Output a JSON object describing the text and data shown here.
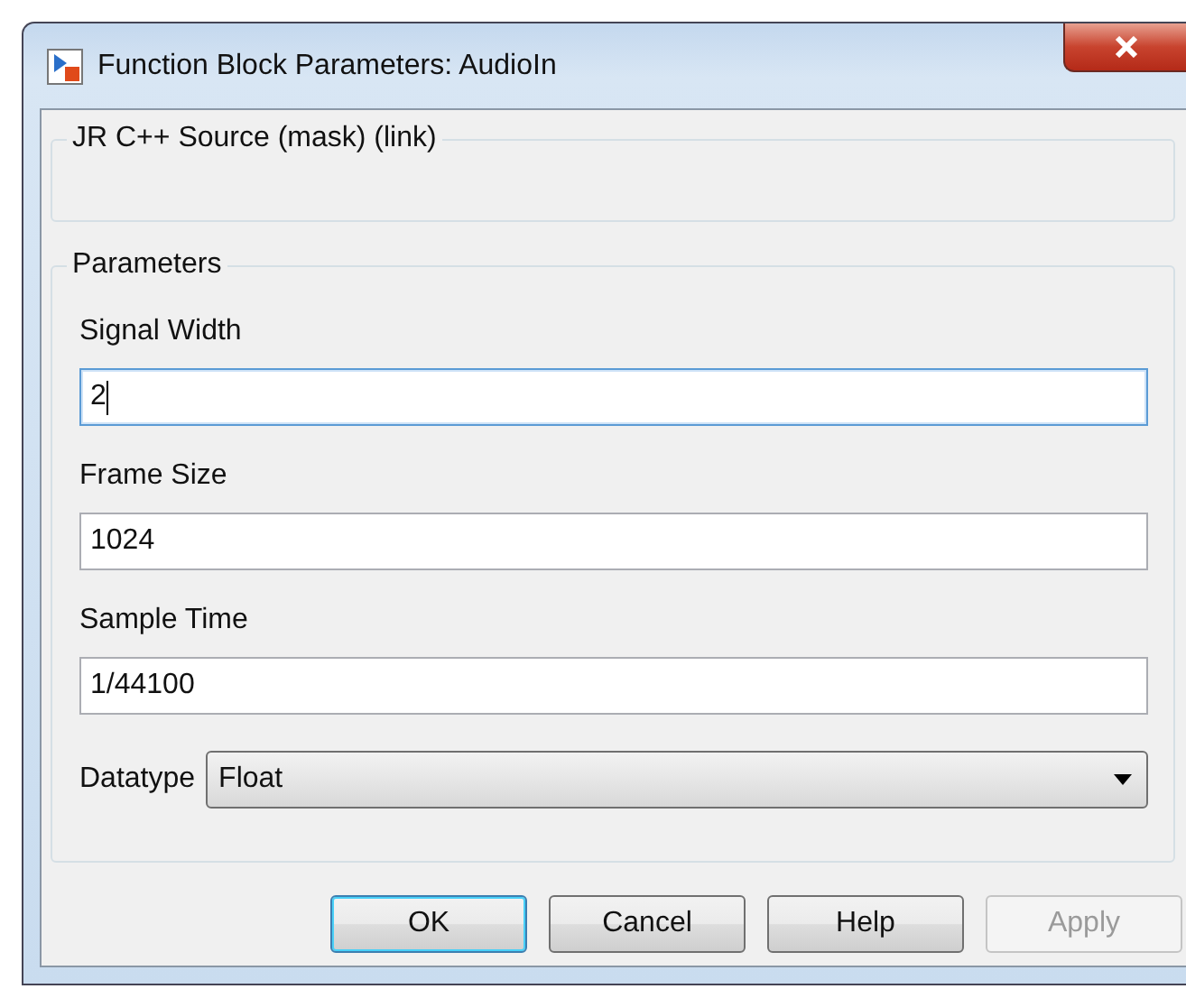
{
  "window": {
    "title": "Function Block Parameters: AudioIn"
  },
  "description_group": {
    "title": "JR C++ Source (mask) (link)"
  },
  "parameters": {
    "title": "Parameters",
    "fields": [
      {
        "kind": "text",
        "label": "Signal Width",
        "value": "2",
        "focused": true
      },
      {
        "kind": "text",
        "label": "Frame Size",
        "value": "1024",
        "focused": false
      },
      {
        "kind": "text",
        "label": "Sample Time",
        "value": "1/44100",
        "focused": false
      },
      {
        "kind": "dropdown",
        "label": "Datatype",
        "value": "Float"
      }
    ]
  },
  "buttons": [
    {
      "label": "OK",
      "default": true,
      "disabled": false
    },
    {
      "label": "Cancel",
      "default": false,
      "disabled": false
    },
    {
      "label": "Help",
      "default": false,
      "disabled": false
    },
    {
      "label": "Apply",
      "default": false,
      "disabled": true
    }
  ]
}
